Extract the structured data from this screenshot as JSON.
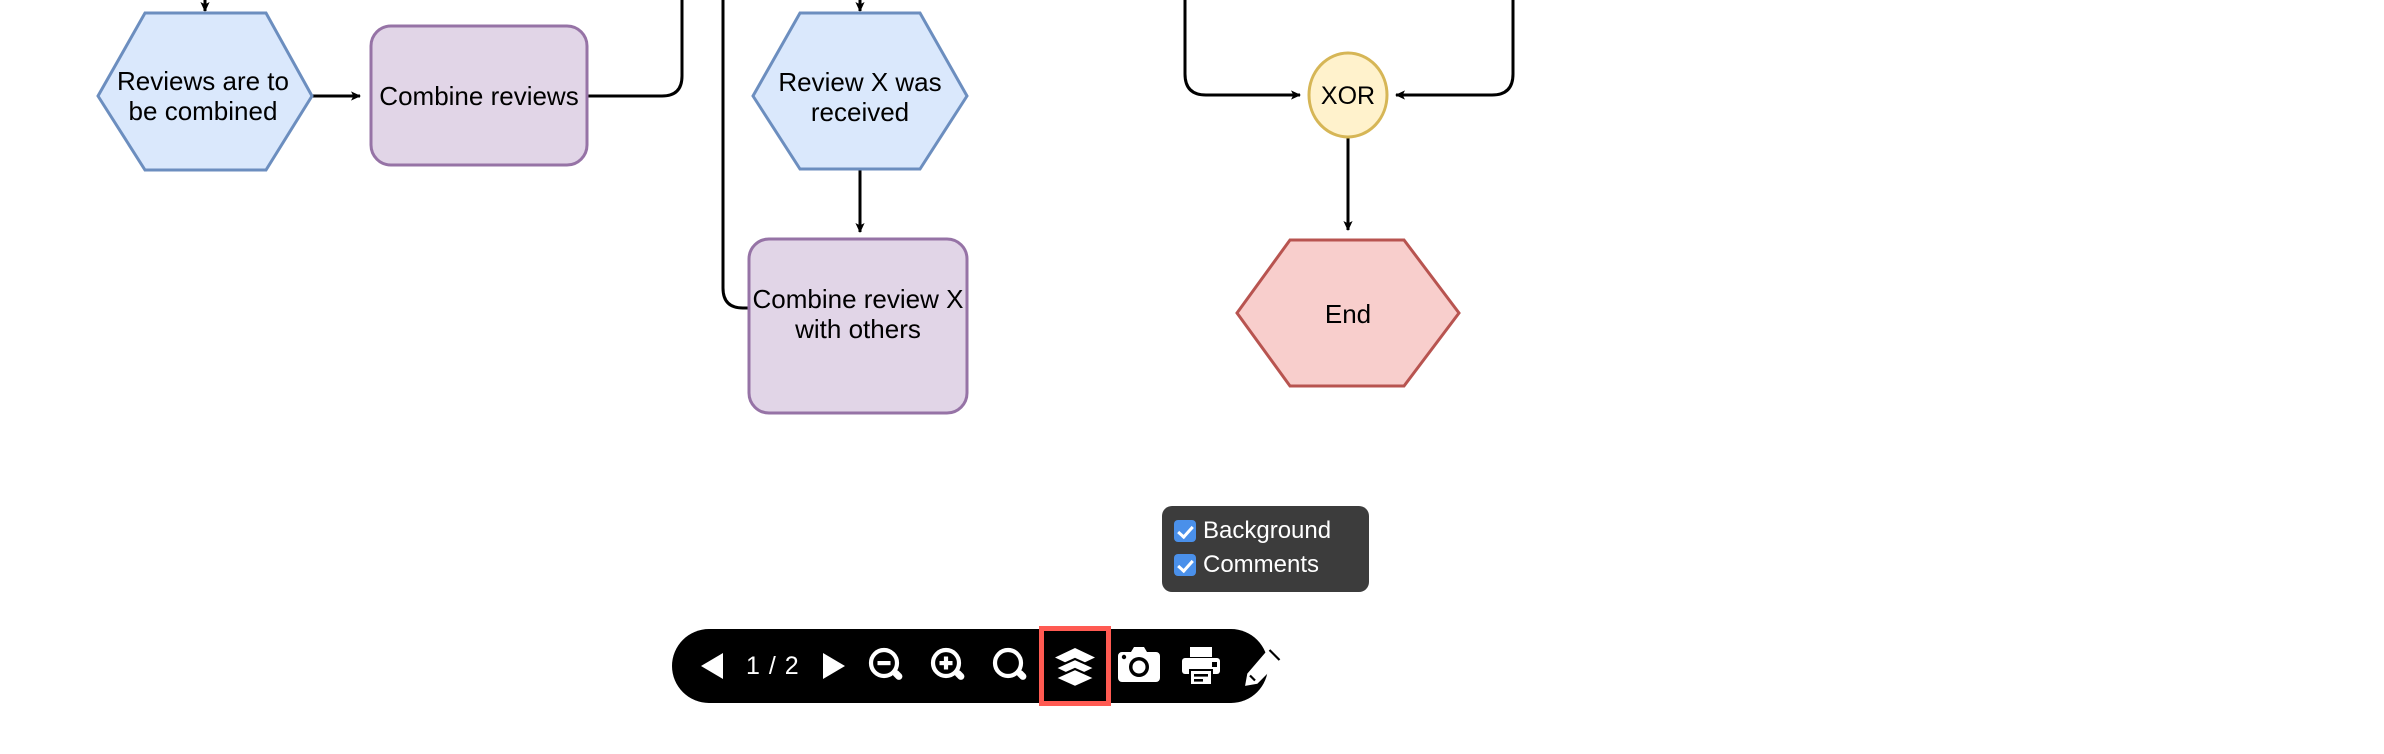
{
  "document": {
    "type": "flowchart-diagram",
    "nodes": [
      {
        "id": "reviews-combined",
        "label_line1": "Reviews are to",
        "label_line2": "be combined",
        "shape": "hexagon",
        "fill": "#dae8fc",
        "stroke": "#6c8ebf"
      },
      {
        "id": "combine-reviews",
        "label_line1": "Combine reviews",
        "label_line2": "",
        "shape": "rounded-rect",
        "fill": "#e1d5e7",
        "stroke": "#9673a6"
      },
      {
        "id": "review-x-received",
        "label_line1": "Review X was",
        "label_line2": "received",
        "shape": "hexagon",
        "fill": "#dae8fc",
        "stroke": "#6c8ebf"
      },
      {
        "id": "combine-review-x",
        "label_line1": "Combine review X",
        "label_line2": "with others",
        "shape": "rounded-rect",
        "fill": "#e1d5e7",
        "stroke": "#9673a6"
      },
      {
        "id": "xor-gateway",
        "label_line1": "XOR",
        "label_line2": "",
        "shape": "ellipse",
        "fill": "#fff2cc",
        "stroke": "#d6b656"
      },
      {
        "id": "end-node",
        "label_line1": "End",
        "label_line2": "",
        "shape": "hexagon",
        "fill": "#f8cecc",
        "stroke": "#b85450"
      }
    ]
  },
  "layers_popup": {
    "visible": true,
    "items": [
      {
        "label": "Background",
        "checked": true
      },
      {
        "label": "Comments",
        "checked": true
      }
    ],
    "background": "#3c3c3c",
    "checkbox_color": "#4a90ea"
  },
  "toolbar": {
    "background": "#000000",
    "highlight_color": "#ff5a52",
    "page_indicator": "1 / 2",
    "buttons": [
      {
        "name": "previous-page",
        "icon": "triangle-left-icon",
        "label": ""
      },
      {
        "name": "page-indicator",
        "icon": "",
        "label": "1 / 2"
      },
      {
        "name": "next-page",
        "icon": "triangle-right-icon",
        "label": ""
      },
      {
        "name": "zoom-out",
        "icon": "magnifier-minus-icon",
        "label": ""
      },
      {
        "name": "zoom-in",
        "icon": "magnifier-plus-icon",
        "label": ""
      },
      {
        "name": "zoom-reset",
        "icon": "magnifier-icon",
        "label": ""
      },
      {
        "name": "layers",
        "icon": "layers-icon",
        "label": "",
        "selected": true
      },
      {
        "name": "snapshot",
        "icon": "camera-icon",
        "label": ""
      },
      {
        "name": "print",
        "icon": "printer-icon",
        "label": ""
      },
      {
        "name": "edit",
        "icon": "pencil-icon",
        "label": ""
      }
    ]
  }
}
